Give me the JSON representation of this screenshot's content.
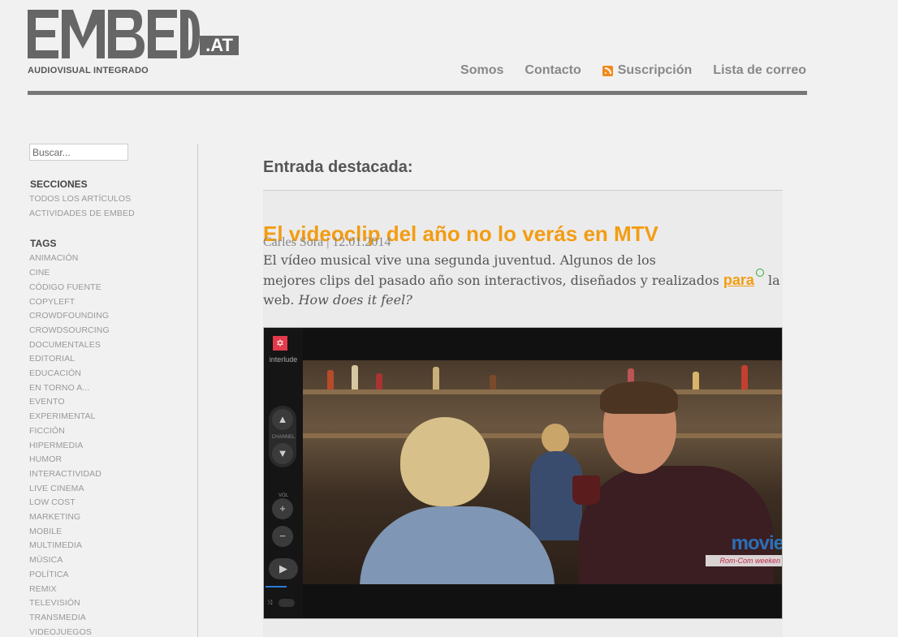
{
  "site": {
    "logo_text": "EMBED",
    "logo_suffix": ".AT",
    "tagline": "AUDIOVISUAL INTEGRADO"
  },
  "nav": {
    "items": [
      "Somos",
      "Contacto",
      "Suscripción",
      "Lista de correo"
    ],
    "rss_icon": "rss-icon"
  },
  "sidebar": {
    "search_placeholder": "Buscar...",
    "sections_heading": "SECCIONES",
    "sections": [
      "TODOS LOS ARTÍCULOS",
      "ACTIVIDADES DE EMBED"
    ],
    "tags_heading": "TAGS",
    "tags": [
      "ANIMACIÓN",
      "CINE",
      "CÓDIGO FUENTE",
      "COPYLEFT",
      "CROWDFOUNDING",
      "CROWDSOURCING",
      "DOCUMENTALES",
      "EDITORIAL",
      "EDUCACIÓN",
      "EN TORNO A...",
      "EVENTO",
      "EXPERIMENTAL",
      "FICCIÓN",
      "HIPERMEDIA",
      "HUMOR",
      "INTERACTIVIDAD",
      "LIVE CINEMA",
      "LOW COST",
      "MARKETING",
      "MOBILE",
      "MULTIMEDIA",
      "MÚSICA",
      "POLÍTICA",
      "REMIX",
      "TELEVISIÓN",
      "TRANSMEDIA",
      "VIDEOJUEGOS"
    ]
  },
  "main": {
    "featured_heading": "Entrada destacada:",
    "post": {
      "title": "El videoclip del año no lo verás en MTV",
      "author": "Carles Sora",
      "separator": "|",
      "date": "12.01.2014",
      "body_line1": "El vídeo musical vive una segunda juventud. Algunos de los",
      "body_line2_start": "mejores clips del pasado año son interactivos, diseñados y realizados",
      "link_text": "para",
      "body_line2_end": "la",
      "body_line3_start": "web.",
      "body_line3_italic": "How does it feel?"
    },
    "video": {
      "brand": "interlude",
      "channel_label": "CHANNEL",
      "vol_label": "VOL",
      "badge_top": "movie",
      "badge_bottom": "Rom-Com weeken"
    }
  },
  "colors": {
    "accent": "#f39c12",
    "nav_text": "#888888",
    "rule": "#777777",
    "background": "#f1f1f1"
  }
}
